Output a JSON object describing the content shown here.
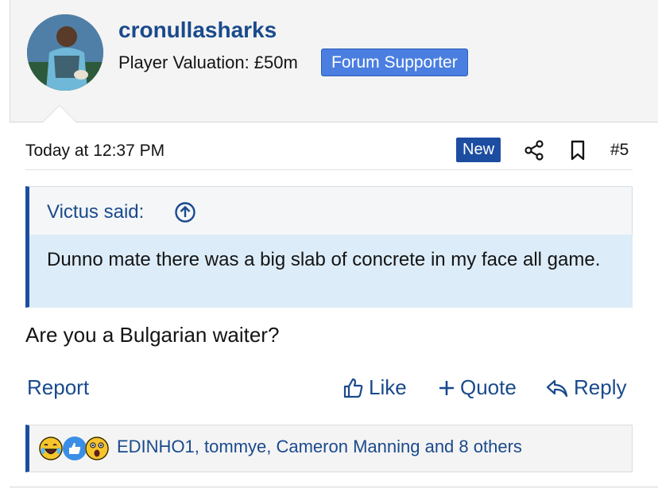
{
  "user": {
    "username": "cronullasharks",
    "valuation": "Player Valuation: £50m",
    "badge": "Forum Supporter"
  },
  "post": {
    "timestamp": "Today at 12:37 PM",
    "new_badge": "New",
    "number": "#5",
    "text": "Are you a Bulgarian waiter?"
  },
  "quote": {
    "author_line": "Victus said:",
    "body": "Dunno mate there was a big slab of concrete in my face all game."
  },
  "actions": {
    "report": "Report",
    "like": "Like",
    "quote": "Quote",
    "reply": "Reply"
  },
  "reactions": {
    "icons": [
      "laughing-emoji",
      "like-emoji",
      "wow-emoji"
    ],
    "text": "EDINHO1, tommye, Cameron Manning and 8 others"
  },
  "colors": {
    "link": "#1a4a8c",
    "accent": "#1c4da1",
    "badge": "#4a7ee0",
    "quote_bg": "#dcecf8"
  }
}
